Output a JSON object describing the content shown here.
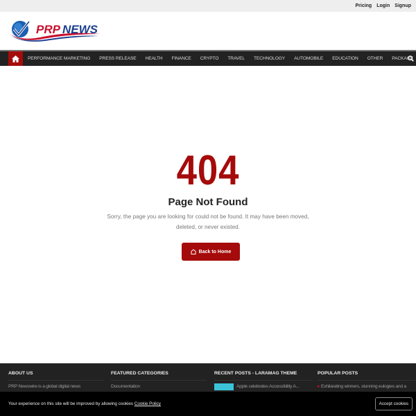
{
  "topbar": {
    "links": [
      "Pricing",
      "Login",
      "Signup"
    ]
  },
  "logo": {
    "text": "PRP NEWS",
    "colors": {
      "red": "#c8102e",
      "blue": "#1b3f8f"
    }
  },
  "nav": {
    "items": [
      "PERFORMANCE MARKETING",
      "PRESS RELEASE",
      "HEALTH",
      "FINANCE",
      "CRYPTO",
      "TRAVEL",
      "TECHNOLOGY",
      "AUTOMOBILE",
      "EDUCATION",
      "OTHER",
      "PACKAGE"
    ],
    "accent": "#a50b0b"
  },
  "error": {
    "code": "404",
    "title": "Page Not Found",
    "message": "Sorry, the page you are looking for could not be found. It may have been moved, deleted, or never existed.",
    "button": "Back to Home"
  },
  "footer": {
    "columns": [
      {
        "title": "ABOUT US",
        "text": "PRP Newswire is a global digital news"
      },
      {
        "title": "FEATURED CATEGORIES",
        "text": "Documentation"
      },
      {
        "title": "RECENT POSTS - LARAMAG THEME",
        "text": "Apple celebrates Accessibility A..."
      },
      {
        "title": "POPULAR POSTS",
        "text": "Exhilarating winners, stunning eulogies and a"
      }
    ]
  },
  "cookie": {
    "text": "Your experience on this site will be improved by allowing cookies",
    "link": "Cookie Policy",
    "button": "Accept cookies"
  }
}
